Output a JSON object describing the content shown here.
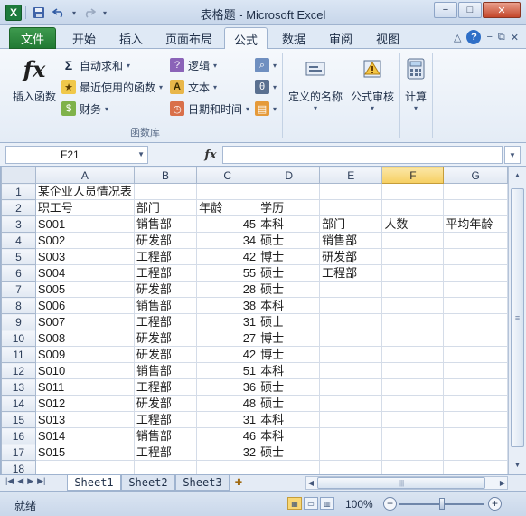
{
  "window": {
    "title": "表格题 - Microsoft Excel",
    "minimize": "−",
    "maximize": "□",
    "close": "✕"
  },
  "qat": {
    "app_icon": "X",
    "save": "💾",
    "undo": "↶",
    "redo": "↷"
  },
  "ribbon_tabs": [
    "文件",
    "开始",
    "插入",
    "页面布局",
    "公式",
    "数据",
    "审阅",
    "视图"
  ],
  "ribbon": {
    "insert_function": "插入函数",
    "autosum": "自动求和",
    "recent": "最近使用的函数",
    "financial": "财务",
    "logical": "逻辑",
    "text": "文本",
    "datetime": "日期和时间",
    "defined_names": "定义的名称",
    "formula_audit": "公式审核",
    "calculation": "计算",
    "group_label": "函数库"
  },
  "formula_bar": {
    "name_box": "F21",
    "fx": "fx",
    "formula": ""
  },
  "columns": [
    "A",
    "B",
    "C",
    "D",
    "E",
    "F",
    "G"
  ],
  "selected_column": "F",
  "rows": [
    [
      "1",
      "某企业人员情况表",
      "",
      "",
      "",
      "",
      "",
      ""
    ],
    [
      "2",
      "职工号",
      "部门",
      "年龄",
      "学历",
      "",
      "",
      ""
    ],
    [
      "3",
      "S001",
      "销售部",
      "45",
      "本科",
      "部门",
      "人数",
      "平均年龄"
    ],
    [
      "4",
      "S002",
      "研发部",
      "34",
      "硕士",
      "销售部",
      "",
      ""
    ],
    [
      "5",
      "S003",
      "工程部",
      "42",
      "博士",
      "研发部",
      "",
      ""
    ],
    [
      "6",
      "S004",
      "工程部",
      "55",
      "硕士",
      "工程部",
      "",
      ""
    ],
    [
      "7",
      "S005",
      "研发部",
      "28",
      "硕士",
      "",
      "",
      ""
    ],
    [
      "8",
      "S006",
      "销售部",
      "38",
      "本科",
      "",
      "",
      ""
    ],
    [
      "9",
      "S007",
      "工程部",
      "31",
      "硕士",
      "",
      "",
      ""
    ],
    [
      "10",
      "S008",
      "研发部",
      "27",
      "博士",
      "",
      "",
      ""
    ],
    [
      "11",
      "S009",
      "研发部",
      "42",
      "博士",
      "",
      "",
      ""
    ],
    [
      "12",
      "S010",
      "销售部",
      "51",
      "本科",
      "",
      "",
      ""
    ],
    [
      "13",
      "S011",
      "工程部",
      "36",
      "硕士",
      "",
      "",
      ""
    ],
    [
      "14",
      "S012",
      "研发部",
      "48",
      "硕士",
      "",
      "",
      ""
    ],
    [
      "15",
      "S013",
      "工程部",
      "31",
      "本科",
      "",
      "",
      ""
    ],
    [
      "16",
      "S014",
      "销售部",
      "46",
      "本科",
      "",
      "",
      ""
    ],
    [
      "17",
      "S015",
      "工程部",
      "32",
      "硕士",
      "",
      "",
      ""
    ],
    [
      "18",
      "",
      "",
      "",
      "",
      "",
      "",
      ""
    ]
  ],
  "sheets": [
    "Sheet1",
    "Sheet2",
    "Sheet3"
  ],
  "active_sheet": "Sheet1",
  "status": {
    "mode": "就绪",
    "zoom": "100%"
  }
}
